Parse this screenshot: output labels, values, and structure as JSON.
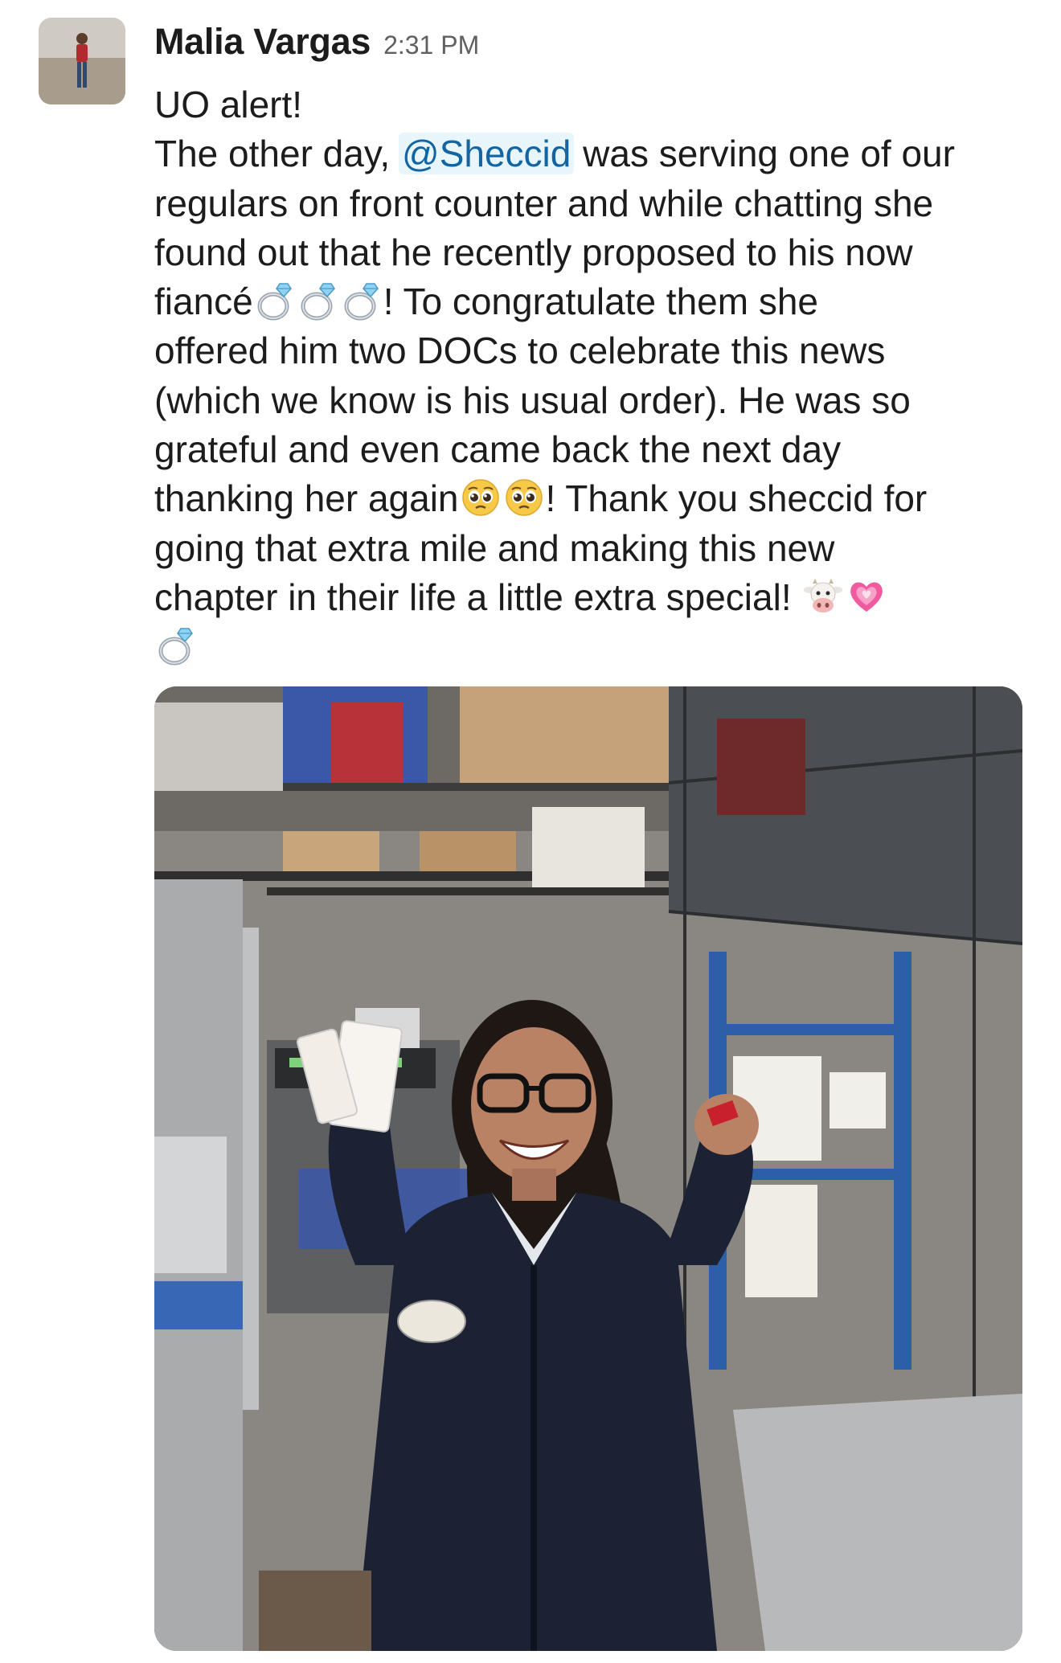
{
  "message": {
    "sender_name": "Malia Vargas",
    "timestamp": "2:31 PM",
    "lines": {
      "l1": "UO alert!",
      "l2_a": "The other day, ",
      "mention": "@Sheccid",
      "l2_b": " was serving one of our",
      "l3": "regulars on front counter and while chatting she",
      "l4": "found out that he recently proposed to his now",
      "l5_a": "fiancé",
      "l5_b": "! To congratulate them she",
      "l6": "offered him two DOCs to celebrate this news",
      "l7": "(which we know is his usual order). He was so",
      "l8": "grateful and even came back the next day",
      "l9_a": "thanking her again",
      "l9_b": "! Thank you sheccid for",
      "l10": "going that extra mile and making this new",
      "l11": "chapter in their life a little extra special! "
    },
    "emojis": {
      "ring": "ring-emoji",
      "pleading": "pleading-face-emoji",
      "cow": "cow-face-emoji",
      "heart": "growing-heart-emoji"
    }
  },
  "attachment": {
    "type": "photo",
    "icon": "photo-attachment"
  }
}
